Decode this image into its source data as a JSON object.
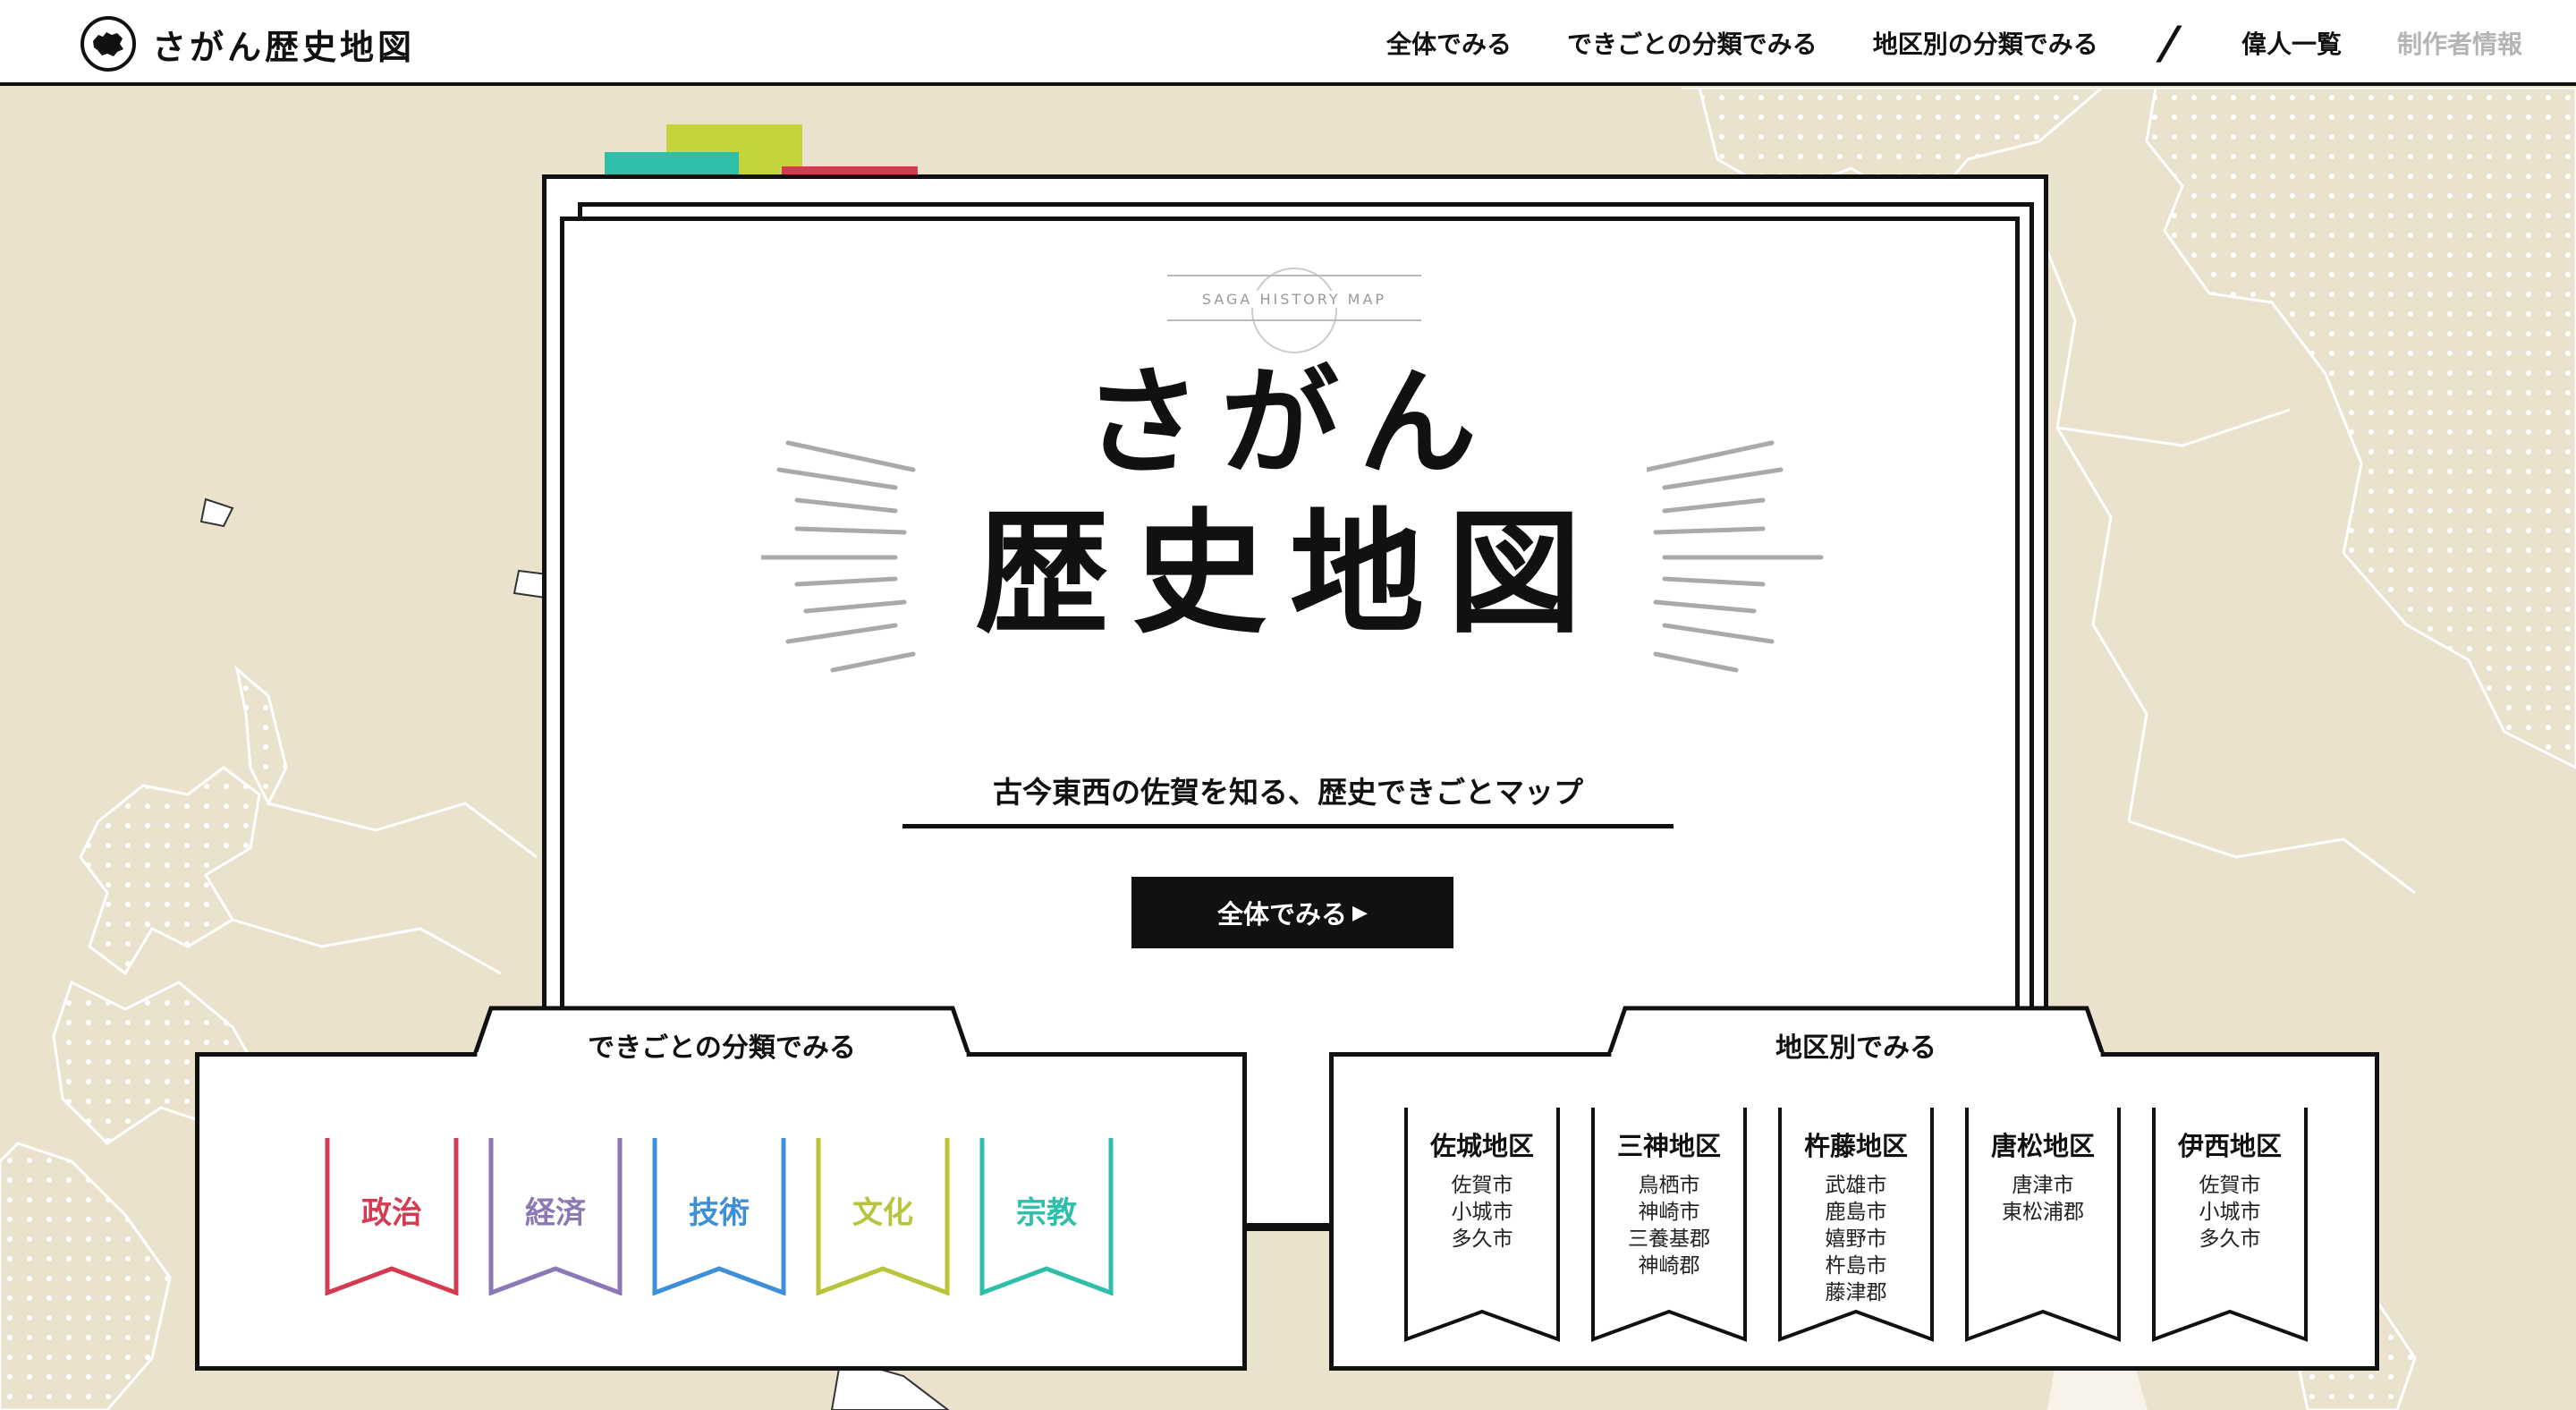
{
  "header": {
    "brand": "さがん歴史地図",
    "nav": [
      {
        "label": "全体でみる",
        "muted": false
      },
      {
        "label": "できごとの分類でみる",
        "muted": false
      },
      {
        "label": "地区別の分類でみる",
        "muted": false
      }
    ],
    "divider": "/",
    "nav_secondary": [
      {
        "label": "偉人一覧",
        "muted": false
      },
      {
        "label": "制作者情報",
        "muted": true
      }
    ]
  },
  "hero": {
    "subtitle_en": "SAGA HISTORY MAP",
    "title_line1": "さがん",
    "title_line2": "歴史地図",
    "tagline": "古今東西の佐賀を知る、歴史できごとマップ",
    "cta_label": "全体でみる",
    "cta_arrow": "▶"
  },
  "categories_panel": {
    "title": "できごとの分類でみる",
    "items": [
      {
        "label": "政治",
        "color": "#d53a50"
      },
      {
        "label": "経済",
        "color": "#8b78b5"
      },
      {
        "label": "技術",
        "color": "#3d8fd8"
      },
      {
        "label": "文化",
        "color": "#b8c43a"
      },
      {
        "label": "宗教",
        "color": "#2fbfa9"
      }
    ]
  },
  "districts_panel": {
    "title": "地区別でみる",
    "items": [
      {
        "name": "佐城地区",
        "cities": [
          "佐賀市",
          "小城市",
          "多久市"
        ]
      },
      {
        "name": "三神地区",
        "cities": [
          "鳥栖市",
          "神崎市",
          "三養基郡",
          "神崎郡"
        ]
      },
      {
        "name": "杵藤地区",
        "cities": [
          "武雄市",
          "鹿島市",
          "嬉野市",
          "杵島市",
          "藤津郡"
        ]
      },
      {
        "name": "唐松地区",
        "cities": [
          "唐津市",
          "東松浦郡"
        ]
      },
      {
        "name": "伊西地区",
        "cities": [
          "佐賀市",
          "小城市",
          "多久市"
        ]
      }
    ]
  },
  "colors": {
    "background": "#ebe2ce",
    "accent_lime": "#c6d43c",
    "accent_teal": "#2fbfa9",
    "accent_red": "#d53a50"
  }
}
